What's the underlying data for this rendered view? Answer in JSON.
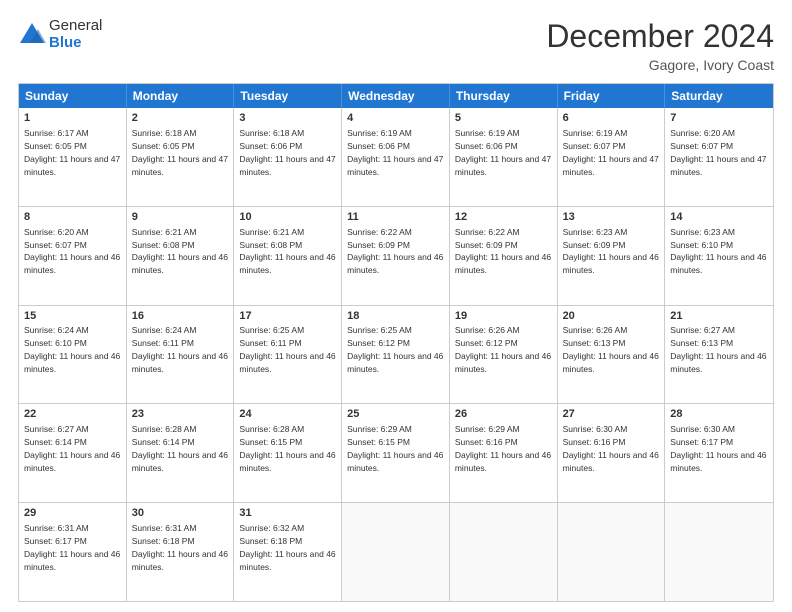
{
  "logo": {
    "general": "General",
    "blue": "Blue"
  },
  "title": "December 2024",
  "subtitle": "Gagore, Ivory Coast",
  "weekdays": [
    "Sunday",
    "Monday",
    "Tuesday",
    "Wednesday",
    "Thursday",
    "Friday",
    "Saturday"
  ],
  "weeks": [
    [
      {
        "day": "1",
        "sunrise": "6:17 AM",
        "sunset": "6:05 PM",
        "daylight": "11 hours and 47 minutes."
      },
      {
        "day": "2",
        "sunrise": "6:18 AM",
        "sunset": "6:05 PM",
        "daylight": "11 hours and 47 minutes."
      },
      {
        "day": "3",
        "sunrise": "6:18 AM",
        "sunset": "6:06 PM",
        "daylight": "11 hours and 47 minutes."
      },
      {
        "day": "4",
        "sunrise": "6:19 AM",
        "sunset": "6:06 PM",
        "daylight": "11 hours and 47 minutes."
      },
      {
        "day": "5",
        "sunrise": "6:19 AM",
        "sunset": "6:06 PM",
        "daylight": "11 hours and 47 minutes."
      },
      {
        "day": "6",
        "sunrise": "6:19 AM",
        "sunset": "6:07 PM",
        "daylight": "11 hours and 47 minutes."
      },
      {
        "day": "7",
        "sunrise": "6:20 AM",
        "sunset": "6:07 PM",
        "daylight": "11 hours and 47 minutes."
      }
    ],
    [
      {
        "day": "8",
        "sunrise": "6:20 AM",
        "sunset": "6:07 PM",
        "daylight": "11 hours and 46 minutes."
      },
      {
        "day": "9",
        "sunrise": "6:21 AM",
        "sunset": "6:08 PM",
        "daylight": "11 hours and 46 minutes."
      },
      {
        "day": "10",
        "sunrise": "6:21 AM",
        "sunset": "6:08 PM",
        "daylight": "11 hours and 46 minutes."
      },
      {
        "day": "11",
        "sunrise": "6:22 AM",
        "sunset": "6:09 PM",
        "daylight": "11 hours and 46 minutes."
      },
      {
        "day": "12",
        "sunrise": "6:22 AM",
        "sunset": "6:09 PM",
        "daylight": "11 hours and 46 minutes."
      },
      {
        "day": "13",
        "sunrise": "6:23 AM",
        "sunset": "6:09 PM",
        "daylight": "11 hours and 46 minutes."
      },
      {
        "day": "14",
        "sunrise": "6:23 AM",
        "sunset": "6:10 PM",
        "daylight": "11 hours and 46 minutes."
      }
    ],
    [
      {
        "day": "15",
        "sunrise": "6:24 AM",
        "sunset": "6:10 PM",
        "daylight": "11 hours and 46 minutes."
      },
      {
        "day": "16",
        "sunrise": "6:24 AM",
        "sunset": "6:11 PM",
        "daylight": "11 hours and 46 minutes."
      },
      {
        "day": "17",
        "sunrise": "6:25 AM",
        "sunset": "6:11 PM",
        "daylight": "11 hours and 46 minutes."
      },
      {
        "day": "18",
        "sunrise": "6:25 AM",
        "sunset": "6:12 PM",
        "daylight": "11 hours and 46 minutes."
      },
      {
        "day": "19",
        "sunrise": "6:26 AM",
        "sunset": "6:12 PM",
        "daylight": "11 hours and 46 minutes."
      },
      {
        "day": "20",
        "sunrise": "6:26 AM",
        "sunset": "6:13 PM",
        "daylight": "11 hours and 46 minutes."
      },
      {
        "day": "21",
        "sunrise": "6:27 AM",
        "sunset": "6:13 PM",
        "daylight": "11 hours and 46 minutes."
      }
    ],
    [
      {
        "day": "22",
        "sunrise": "6:27 AM",
        "sunset": "6:14 PM",
        "daylight": "11 hours and 46 minutes."
      },
      {
        "day": "23",
        "sunrise": "6:28 AM",
        "sunset": "6:14 PM",
        "daylight": "11 hours and 46 minutes."
      },
      {
        "day": "24",
        "sunrise": "6:28 AM",
        "sunset": "6:15 PM",
        "daylight": "11 hours and 46 minutes."
      },
      {
        "day": "25",
        "sunrise": "6:29 AM",
        "sunset": "6:15 PM",
        "daylight": "11 hours and 46 minutes."
      },
      {
        "day": "26",
        "sunrise": "6:29 AM",
        "sunset": "6:16 PM",
        "daylight": "11 hours and 46 minutes."
      },
      {
        "day": "27",
        "sunrise": "6:30 AM",
        "sunset": "6:16 PM",
        "daylight": "11 hours and 46 minutes."
      },
      {
        "day": "28",
        "sunrise": "6:30 AM",
        "sunset": "6:17 PM",
        "daylight": "11 hours and 46 minutes."
      }
    ],
    [
      {
        "day": "29",
        "sunrise": "6:31 AM",
        "sunset": "6:17 PM",
        "daylight": "11 hours and 46 minutes."
      },
      {
        "day": "30",
        "sunrise": "6:31 AM",
        "sunset": "6:18 PM",
        "daylight": "11 hours and 46 minutes."
      },
      {
        "day": "31",
        "sunrise": "6:32 AM",
        "sunset": "6:18 PM",
        "daylight": "11 hours and 46 minutes."
      },
      null,
      null,
      null,
      null
    ]
  ]
}
